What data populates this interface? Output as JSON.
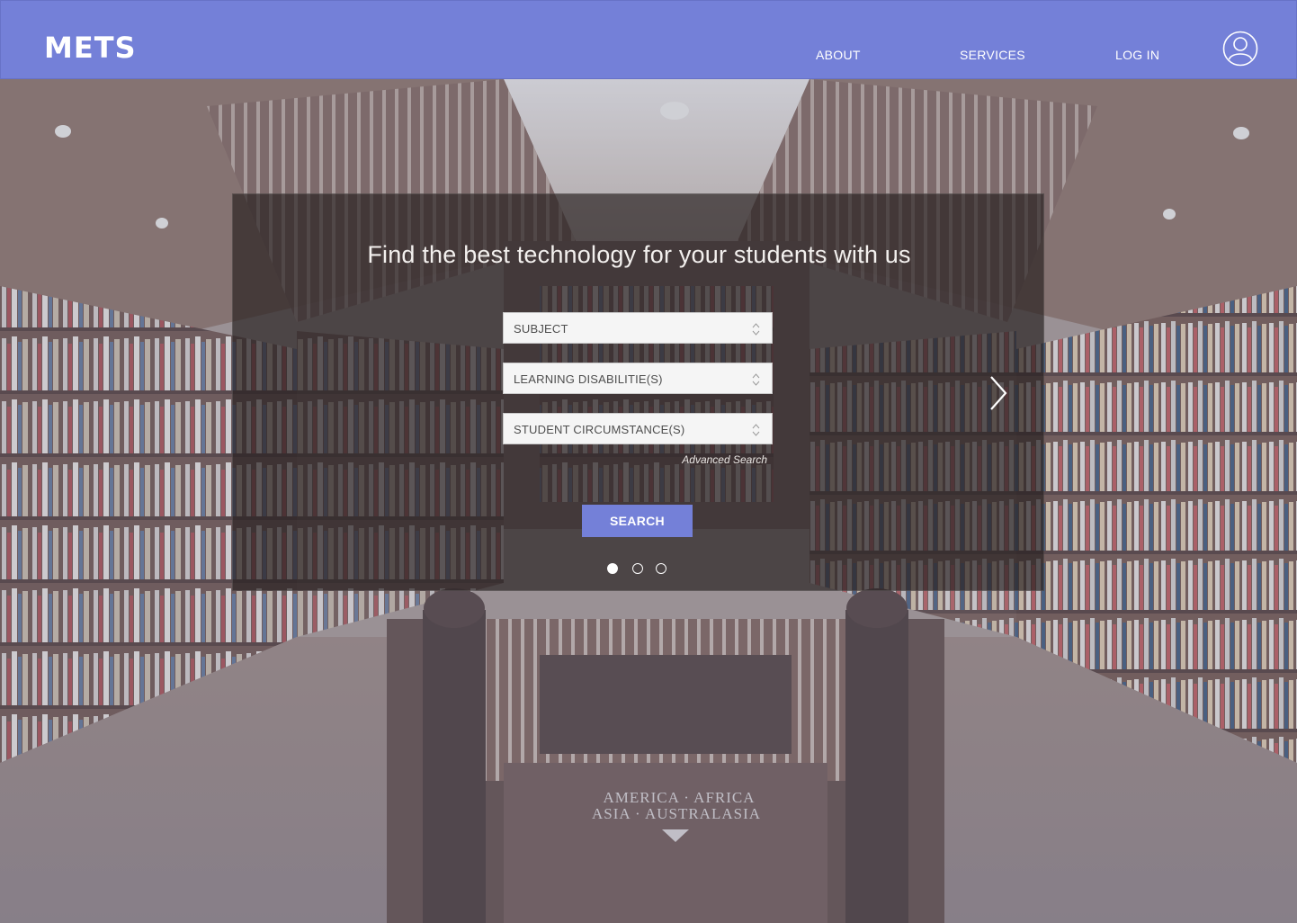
{
  "header": {
    "brand": "METS",
    "nav": {
      "about": "ABOUT",
      "services": "SERVICES",
      "login": "LOG IN"
    },
    "avatar_icon": "user-profile-icon"
  },
  "hero": {
    "headline": "Find the best technology for your students with us",
    "filters": {
      "subject": "SUBJECT",
      "disabilities": "LEARNING DISABILITIE(S)",
      "circumstances": "STUDENT CIRCUMSTANCE(S)"
    },
    "advanced_search": "Advanced Search",
    "search_button": "SEARCH",
    "carousel": {
      "slide_count": 3,
      "active_slide": 1,
      "next_icon": "chevron-right-icon"
    },
    "background_sign": {
      "line1": "AMERICA · AFRICA",
      "line2": "ASIA · AUSTRALASIA"
    }
  },
  "colors": {
    "brand": "#7480d8",
    "panel_overlay": "rgba(40,32,32,0.68)",
    "field_bg": "#f5f5f5"
  }
}
